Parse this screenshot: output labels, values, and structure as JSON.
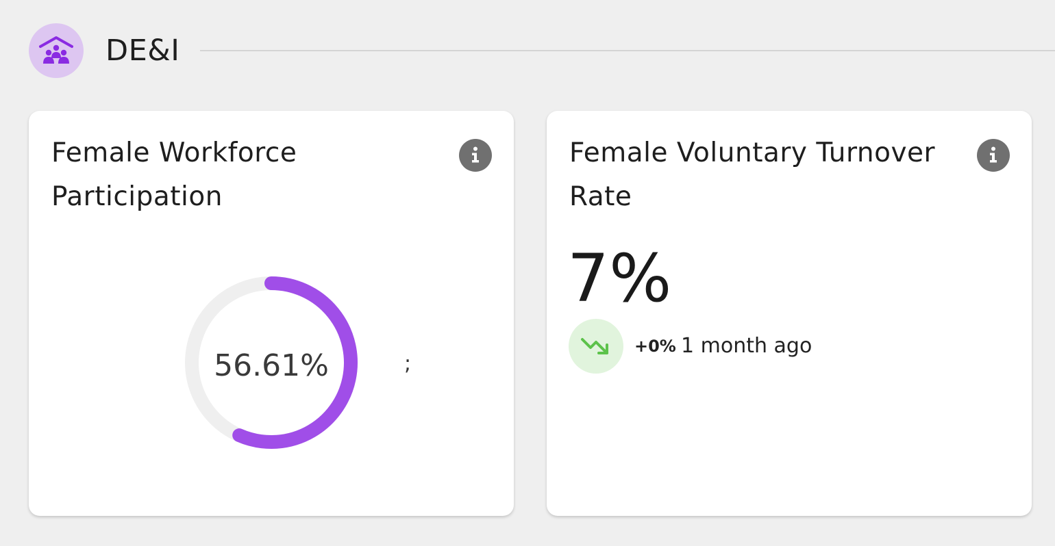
{
  "section": {
    "icon": "team-house-icon",
    "title": "DE&I"
  },
  "cards": [
    {
      "title": "Female Workforce Participation",
      "info_icon": "info-icon",
      "value": "56.61%",
      "progress_percent": 56.61,
      "stray_text": ";",
      "colors": {
        "arc": "#a04ee8",
        "track": "#efefef"
      }
    },
    {
      "title": "Female Voluntary Turnover Rate",
      "info_icon": "info-icon",
      "value": "7%",
      "trend": {
        "icon": "trending-down-icon",
        "change": "+0%",
        "period": "1 month ago",
        "colors": {
          "icon": "#5cc24a",
          "background": "#e1f4dd"
        }
      }
    }
  ],
  "colors": {
    "brand": "#8a2be2",
    "brand_soft": "#ddc6f1",
    "info": "#707070"
  }
}
